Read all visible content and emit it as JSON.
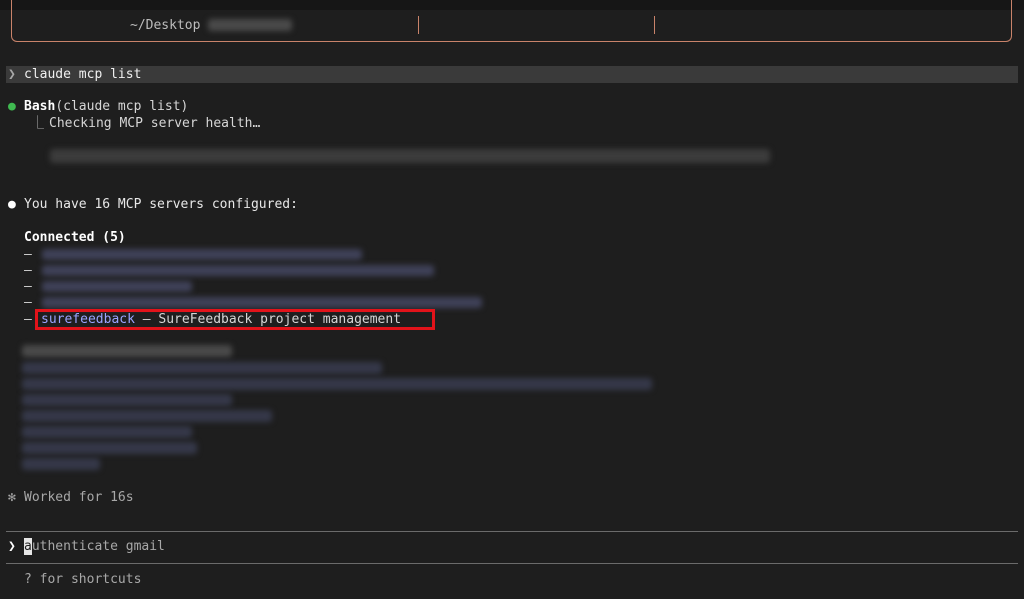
{
  "top_box": {
    "path": "~/Desktop"
  },
  "command": {
    "prompt": "❯",
    "text": "claude mcp list"
  },
  "bash_call": {
    "bullet": "●",
    "tool": "Bash",
    "args": "(claude mcp list)",
    "branch": "⎿",
    "status": "Checking MCP server health…"
  },
  "summary": {
    "bullet": "●",
    "text": "You have 16 MCP servers configured:"
  },
  "connected": {
    "heading": "Connected (5)",
    "dash": "–",
    "highlighted_item": {
      "name": "surefeedback",
      "separator": " — ",
      "description": "SureFeedback project management"
    }
  },
  "footer": {
    "worked_icon": "✻",
    "worked_text": "Worked for 16s",
    "input_prompt": "❯",
    "input_cursor_char": "a",
    "input_rest": "uthenticate gmail",
    "shortcuts": "? for shortcuts"
  },
  "colors": {
    "background": "#1e1e1e",
    "box_border": "#c9836a",
    "highlight": "#e2131a",
    "server_name": "#9aa3ff",
    "status_green": "#3fb950"
  }
}
